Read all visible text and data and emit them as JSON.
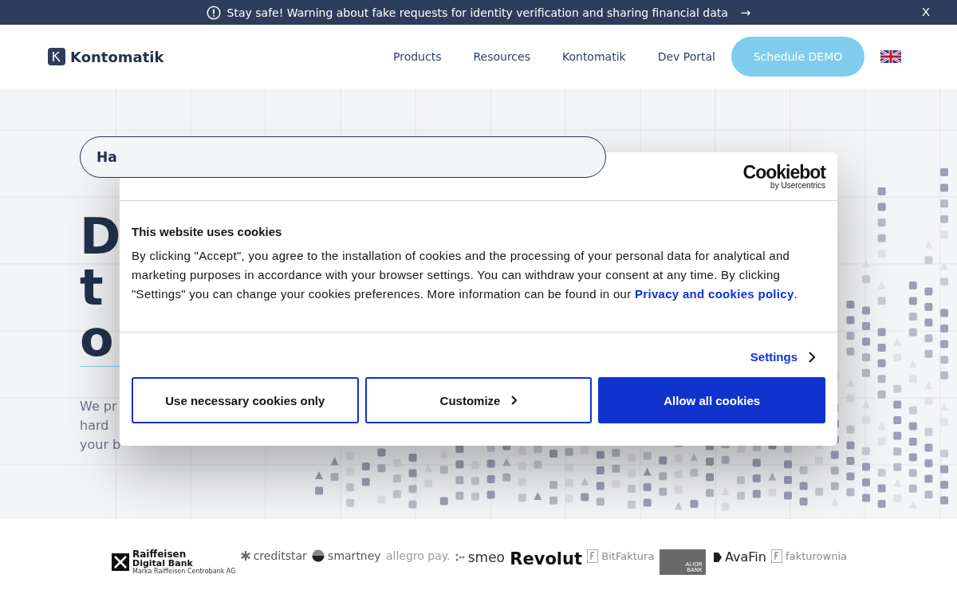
{
  "banner": {
    "text": "Stay safe! Warning about fake requests for identity verification and sharing financial data",
    "arrow": "→",
    "close": "X"
  },
  "nav": {
    "logo": "Kontomatik",
    "items": [
      "Products",
      "Resources",
      "Kontomatik",
      "Dev Portal"
    ],
    "cta": "Schedule DEMO"
  },
  "hero": {
    "search_text": "Ha",
    "heading_lines": [
      "D",
      "t",
      "o"
    ],
    "paragraph_lines": [
      "We pr",
      "hard",
      "your b"
    ]
  },
  "cookie_dialog": {
    "brand": "Cookiebot",
    "brand_sub": "by Usercentrics",
    "title": "This website uses cookies",
    "body": "By clicking \"Accept\", you agree to the installation of cookies and the processing of your personal data for analytical and marketing purposes in accordance with your browser settings. You can withdraw your consent at any time. By clicking \"Settings\" you can change your cookies preferences. More information can be found in our ",
    "link": "Privacy and cookies policy",
    "body_end": ".",
    "settings": "Settings",
    "buttons": [
      {
        "label": "Use necessary cookies only",
        "kind": "outline"
      },
      {
        "label": "Customize",
        "kind": "outline-chevron"
      },
      {
        "label": "Allow all cookies",
        "kind": "primary"
      }
    ]
  },
  "partners": [
    {
      "kind": "raiffeisen",
      "name": "Raiffeisen",
      "sub": "Digital Bank",
      "tiny": "Marka Raiffeisen Centrobank AG"
    },
    {
      "kind": "star",
      "name": "creditstar"
    },
    {
      "kind": "circle",
      "name": "smartney"
    },
    {
      "kind": "plain",
      "name": "allegro pay."
    },
    {
      "kind": "dots",
      "name": "smeo"
    },
    {
      "kind": "bold",
      "name": "Revolut"
    },
    {
      "kind": "doc",
      "name": "BitFaktura"
    },
    {
      "kind": "alior",
      "name": "ALIOR",
      "sub": "BANK"
    },
    {
      "kind": "ava",
      "name": "AvaFin"
    },
    {
      "kind": "doc",
      "name": "fakturownia"
    }
  ]
}
